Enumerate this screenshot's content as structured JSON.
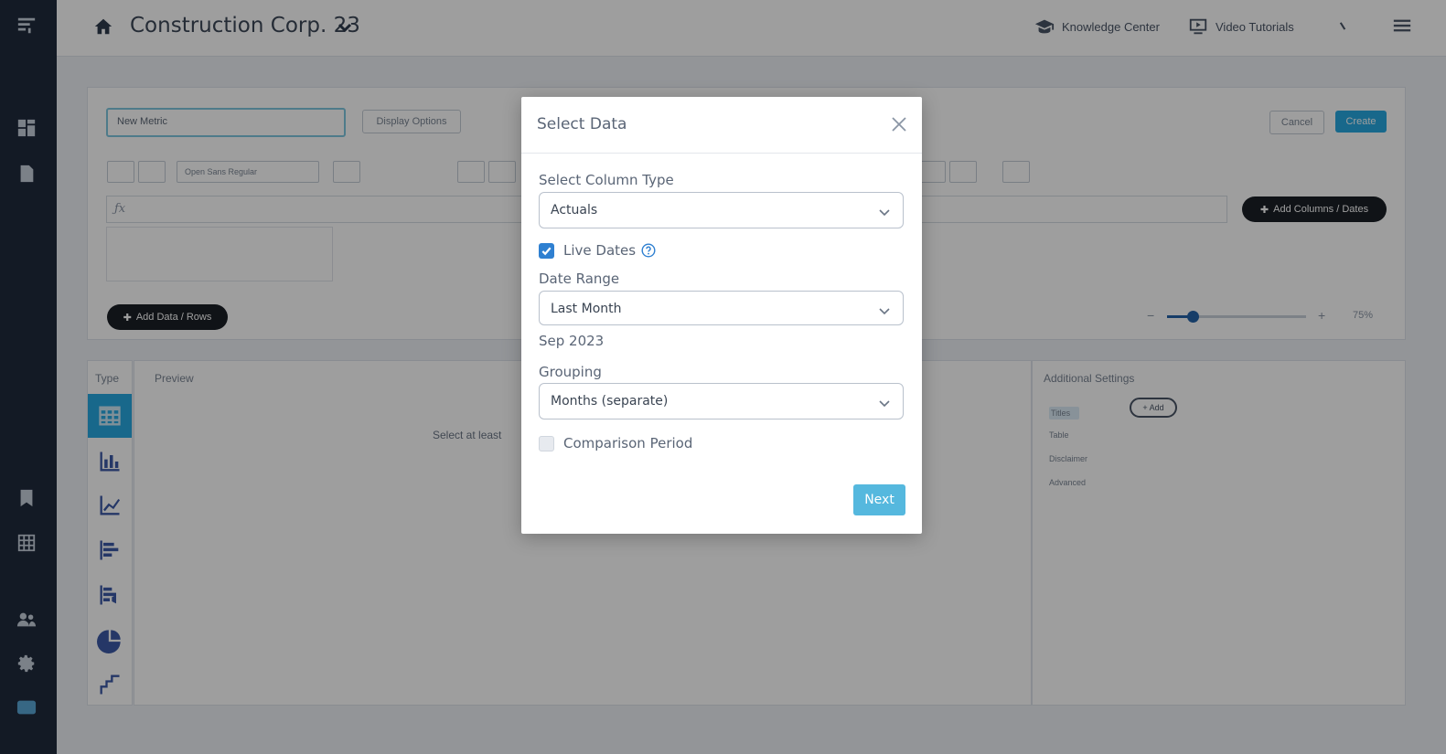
{
  "topbar": {
    "company": "Construction Corp. 23",
    "knowledge_center": "Knowledge Center",
    "video_tutorials": "Video Tutorials"
  },
  "editor": {
    "metric_name": "New Metric",
    "display_options": "Display Options",
    "cancel": "Cancel",
    "create": "Create",
    "font_select": "Open Sans Regular",
    "add_columns": "Add Columns / Dates",
    "add_data": "Add Data / Rows",
    "zoom": "75%"
  },
  "panels": {
    "type_label": "Type",
    "preview_label": "Preview",
    "preview_hint": "Select at least",
    "settings_label": "Additional Settings",
    "settings_items": [
      "Titles",
      "Table",
      "Disclaimer",
      "Advanced"
    ],
    "add_label": "+ Add"
  },
  "modal": {
    "title": "Select Data",
    "column_type_label": "Select Column Type",
    "column_type_value": "Actuals",
    "live_dates_label": "Live Dates",
    "live_dates_checked": true,
    "date_range_label": "Date Range",
    "date_range_value": "Last Month",
    "date_range_display": "Sep 2023",
    "grouping_label": "Grouping",
    "grouping_value": "Months (separate)",
    "comparison_label": "Comparison Period",
    "comparison_checked": false,
    "next_label": "Next"
  },
  "colors": {
    "accent": "#28a9e0",
    "checkbox": "#2f80d1",
    "next_button": "#55b8de",
    "rail": "#1f2a3c"
  }
}
